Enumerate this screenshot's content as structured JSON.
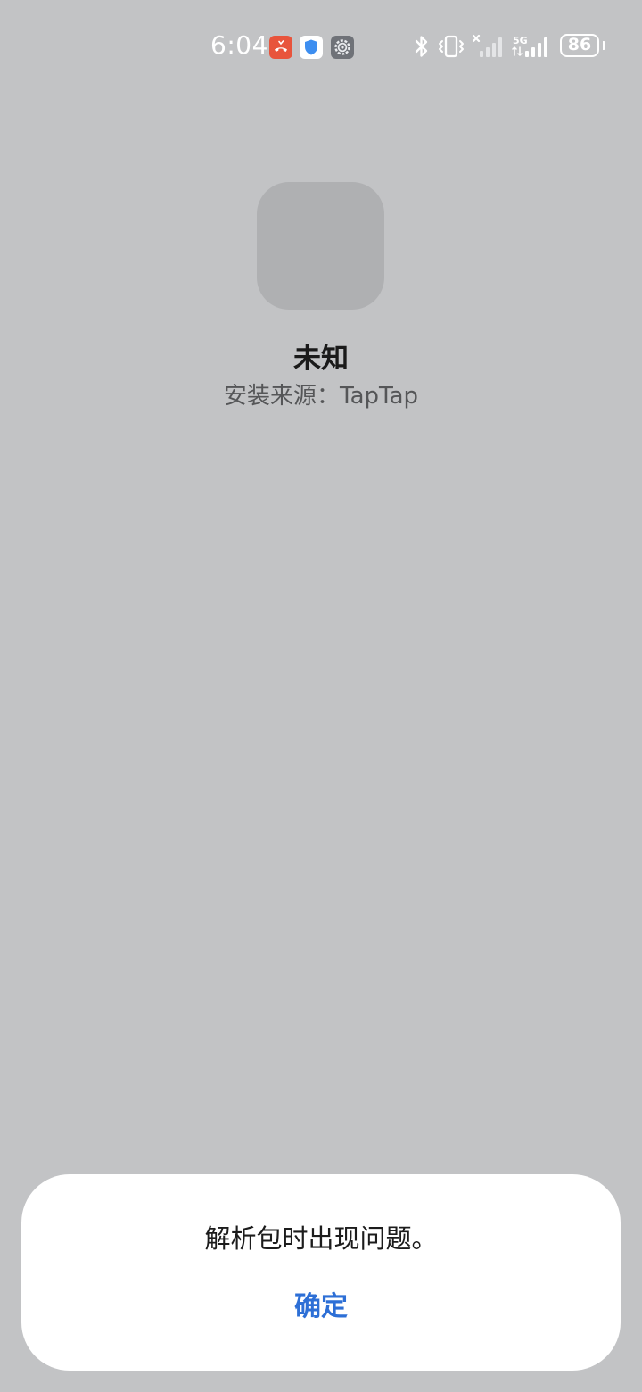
{
  "status_bar": {
    "time": "6:04",
    "battery": "86",
    "network": "5G",
    "icons": [
      "missed-call-icon",
      "shield-icon",
      "settings-gear-icon",
      "bluetooth-icon",
      "vibrate-icon",
      "no-signal-icon",
      "signal-icon",
      "battery-icon"
    ]
  },
  "app": {
    "name": "未知",
    "install_source": "安装来源：TapTap"
  },
  "dialog": {
    "message": "解析包时出现问题。",
    "confirm_label": "确定"
  },
  "colors": {
    "background": "#c2c3c5",
    "accent": "#2d6fd6",
    "missed_call": "#e8543c",
    "shield": "#3d8ef0"
  }
}
